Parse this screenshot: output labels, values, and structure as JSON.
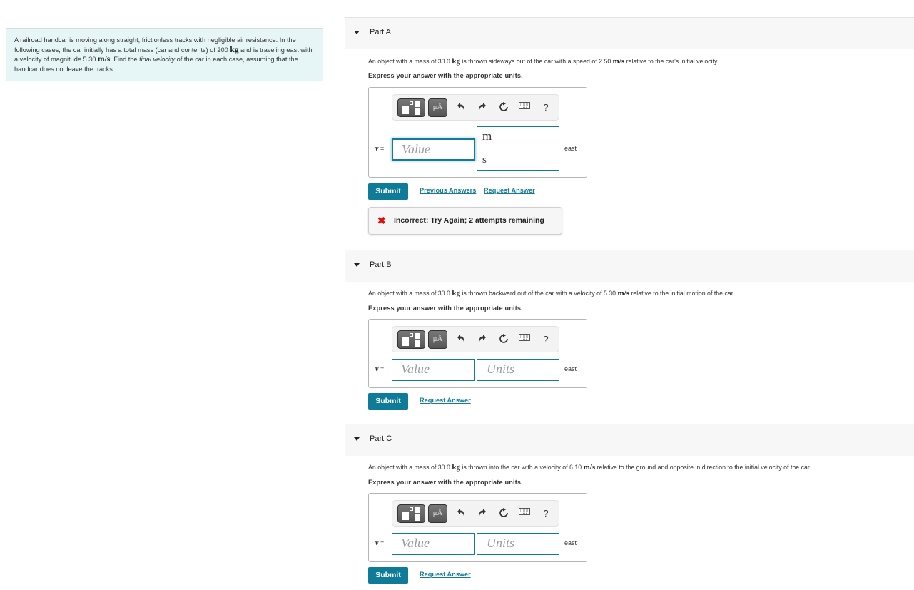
{
  "problem": {
    "intro_parts": [
      "A railroad handcar is moving along straight, frictionless tracks with negligible air resistance. In the following cases, the car initially has a total mass (car and contents) of 200 ",
      "kg",
      " and is traveling east with a velocity of magnitude 5.30 ",
      "m/s",
      ". Find the ",
      "final velocity",
      " of the car in each case, assuming that the handcar does not leave the tracks."
    ]
  },
  "toolbar": {
    "templates_icon": "templates-icon",
    "units_label": "μÅ",
    "undo_icon": "undo-icon",
    "redo_icon": "redo-icon",
    "reset_icon": "reset-icon",
    "keyboard_icon": "keyboard-icon",
    "help_label": "?"
  },
  "common": {
    "instruction": "Express your answer with the appropriate units.",
    "variable_label": "v",
    "equals": "=",
    "direction": "east",
    "submit_label": "Submit",
    "request_answer_label": "Request Answer",
    "previous_answers_label": "Previous Answers",
    "value_placeholder": "Value",
    "units_placeholder": "Units"
  },
  "parts": [
    {
      "title": "Part A",
      "question_parts": [
        "An object with a mass of 30.0 ",
        "kg",
        " is thrown sideways out of the car with a speed of 2.50 ",
        "m/s",
        " relative to the car's initial velocity."
      ],
      "value": "",
      "units": {
        "numerator": "m",
        "denominator": "s"
      },
      "feedback": {
        "icon": "✖",
        "message": "Incorrect; Try Again; 2 attempts remaining",
        "color": "#e00d0d"
      }
    },
    {
      "title": "Part B",
      "question_parts": [
        "An object with a mass of 30.0 ",
        "kg",
        " is thrown backward out of the car with a velocity of 5.30 ",
        "m/s",
        " relative to the initial motion of the car."
      ],
      "value": "",
      "units": ""
    },
    {
      "title": "Part C",
      "question_parts": [
        "An object with a mass of 30.0 ",
        "kg",
        " is thrown into the car with a velocity of 6.10 ",
        "m/s",
        " relative to the ground and opposite in direction to the initial velocity of the car."
      ],
      "value": "",
      "units": ""
    }
  ],
  "colors": {
    "accent": "#0e7c99",
    "intro_bg": "#e6f5f6",
    "header_bg": "#f7f7f7",
    "error": "#e00d0d"
  }
}
